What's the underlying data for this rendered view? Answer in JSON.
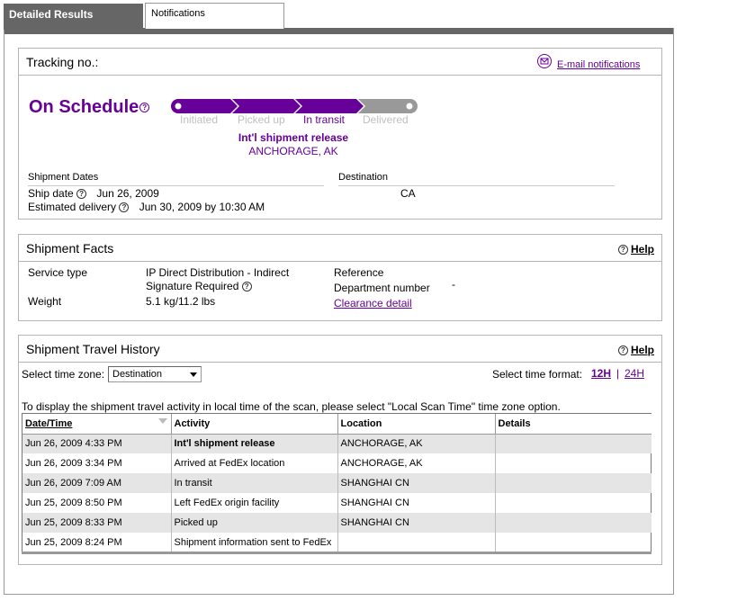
{
  "tabs": {
    "active": "Detailed Results",
    "inactive": "Notifications"
  },
  "tracking": {
    "label": "Tracking no.:",
    "email_link": "E-mail notifications",
    "status": "On Schedule",
    "steps": [
      {
        "label": "Initiated",
        "state": "done"
      },
      {
        "label": "Picked up",
        "state": "done"
      },
      {
        "label": "In transit",
        "state": "current"
      },
      {
        "label": "Delivered",
        "state": "pending"
      }
    ],
    "event": "Int'l shipment release",
    "event_location": "ANCHORAGE, AK",
    "dates_header": "Shipment Dates",
    "destination_header": "Destination",
    "ship_date_label": "Ship date",
    "ship_date": "Jun 26, 2009",
    "est_delivery_label": "Estimated delivery",
    "est_delivery": "Jun 30, 2009 by 10:30 AM",
    "destination": "CA"
  },
  "facts": {
    "title": "Shipment Facts",
    "help": "Help",
    "service_type_label": "Service type",
    "service_type_line1": "IP Direct Distribution - Indirect",
    "service_type_line2": "Signature Required",
    "weight_label": "Weight",
    "weight": "5.1 kg/11.2 lbs",
    "reference_label": "Reference",
    "department_label": "Department number",
    "department_value": "-",
    "clearance_link": "Clearance detail"
  },
  "history": {
    "title": "Shipment Travel History",
    "help": "Help",
    "timezone_label": "Select time zone:",
    "timezone_value": "Destination",
    "format_label": "Select time format:",
    "format_12h": "12H",
    "format_sep": "|",
    "format_24h": "24H",
    "note": "To display the shipment travel activity in local time of the scan, please select \"Local Scan Time\" time zone option.",
    "columns": [
      "Date/Time",
      "Activity",
      "Location",
      "Details"
    ],
    "rows": [
      {
        "datetime": "Jun 26, 2009 4:33 PM",
        "activity": "Int'l shipment release",
        "location": "ANCHORAGE, AK",
        "details": ""
      },
      {
        "datetime": "Jun 26, 2009 3:34 PM",
        "activity": "Arrived at FedEx location",
        "location": "ANCHORAGE, AK",
        "details": ""
      },
      {
        "datetime": "Jun 26, 2009 7:09 AM",
        "activity": "In transit",
        "location": "SHANGHAI CN",
        "details": ""
      },
      {
        "datetime": "Jun 25, 2009 8:50 PM",
        "activity": "Left FedEx origin facility",
        "location": "SHANGHAI CN",
        "details": ""
      },
      {
        "datetime": "Jun 25, 2009 8:33 PM",
        "activity": "Picked up",
        "location": "SHANGHAI CN",
        "details": ""
      },
      {
        "datetime": "Jun 25, 2009 8:24 PM",
        "activity": "Shipment information sent to FedEx",
        "location": "",
        "details": ""
      }
    ]
  },
  "colors": {
    "brand_purple": "#660099",
    "tab_gray": "#666666",
    "row_shade": "#e5e5e5"
  }
}
